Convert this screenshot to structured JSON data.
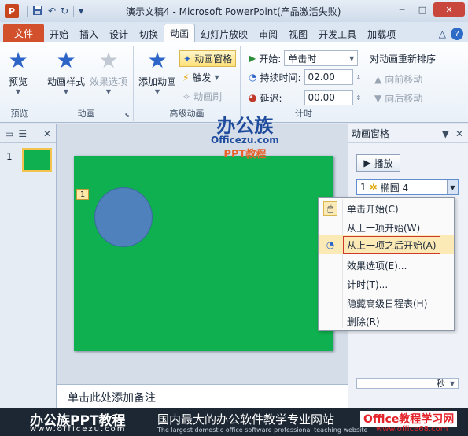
{
  "app": {
    "icon_letter": "P",
    "title": "演示文稿4 - Microsoft PowerPoint(产品激活失败)"
  },
  "window": {
    "minimize": "─",
    "maximize": "□",
    "close": "✕"
  },
  "qat": {
    "save_icon": "save-icon",
    "undo": "↶",
    "redo": "↻",
    "customize": "▾"
  },
  "tabs": [
    "开始",
    "插入",
    "设计",
    "切换",
    "动画",
    "幻灯片放映",
    "审阅",
    "视图",
    "开发工具",
    "加载项"
  ],
  "file_tab": "文件",
  "active_tab": "动画",
  "ribbon": {
    "preview": {
      "label": "预览",
      "group": "预览"
    },
    "animation": {
      "styles_label": "动画样式",
      "effect_options_label": "效果选项",
      "group": "动画"
    },
    "advanced": {
      "add_animation_label": "添加动画",
      "animation_pane_label": "动画窗格",
      "trigger_label": "触发",
      "painter_label": "动画刷",
      "group": "高级动画"
    },
    "timing": {
      "start_label": "开始:",
      "start_value": "单击时",
      "duration_label": "持续时间:",
      "duration_value": "02.00",
      "delay_label": "延迟:",
      "delay_value": "00.00",
      "reorder_title": "对动画重新排序",
      "move_earlier": "向前移动",
      "move_later": "向后移动",
      "group": "计时"
    }
  },
  "watermark": {
    "line1": "办公族",
    "line2": "Officezu.com",
    "line3": "PPT教程"
  },
  "thumbnails": {
    "slide_number": "1"
  },
  "slide": {
    "anim_tag": "1"
  },
  "notes": {
    "placeholder": "单击此处添加备注"
  },
  "anim_pane": {
    "title": "动画窗格",
    "play_label": "播放",
    "item_number": "1",
    "item_name": "椭圆 4",
    "timeline_unit": "秒"
  },
  "context_menu": {
    "items": [
      {
        "label": "单击开始(C)"
      },
      {
        "label": "从上一项开始(W)"
      },
      {
        "label": "从上一项之后开始(A)"
      },
      {
        "label": "效果选项(E)..."
      },
      {
        "label": "计时(T)..."
      },
      {
        "label": "隐藏高级日程表(H)"
      },
      {
        "label": "删除(R)"
      }
    ]
  },
  "footer": {
    "brand": "办公族PPT教程",
    "brand_url": "www.officezu.com",
    "slogan": "国内最大的办公软件教学专业网站",
    "slogan_en": "The largest domestic office software professional teaching website",
    "site": "Office教程学习网",
    "site_url": "www.office68.com"
  },
  "colors": {
    "file_tab": "#d2502b",
    "slide_bg": "#0fb04f",
    "oval": "#4f81bd",
    "highlight": "#fbe9b6"
  }
}
